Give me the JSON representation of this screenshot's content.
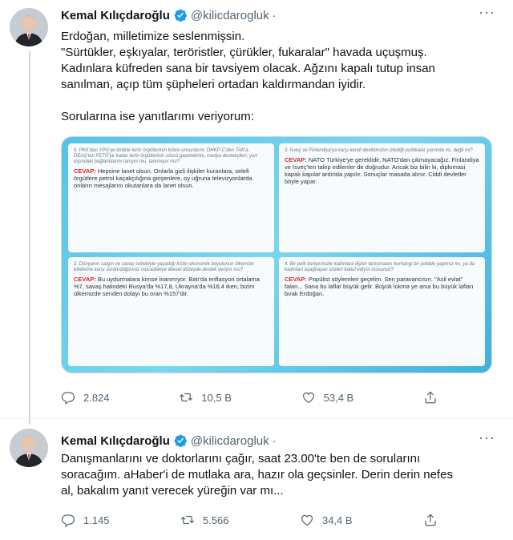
{
  "tweets": [
    {
      "author_name": "Kemal Kılıçdaroğlu",
      "handle": "@kilicdarogluk",
      "separator": "·",
      "lines": [
        "Erdoğan, milletimize seslenmişsin.",
        "\"Sürtükler, eşkıyalar, teröristler, çürükler, fukaralar\" havada uçuşmuş.",
        "Kadınlara küfreden sana bir tavsiyem olacak. Ağzını kapalı tutup insan",
        "sanılman, açıp tüm şüpheleri ortadan kaldırmandan iyidir.",
        "Sorularına ise yanıtlarımı veriyorum:"
      ],
      "media_panels": [
        {
          "question": "5. PKK'dan YPG'ye birlikte terör örgütlerinin listesi unsurlarını; DHKP-C'den TAK'a, DEAŞ'tan FETÖ'ye kadar terör örgütlerinin sözcü gazetelerini, medya destekçileri, yurt dışındaki bağlantılarını tanıyor mu, tanımıyor mu?",
          "label": "CEVAP:",
          "answer": "Hepsine lanet olsun. Onlarla gizli ilişkiler kuranlara, selefi örgütlere petrol kaçakçılığına girişenlere, oy uğruna televizyonlarda onların mesajlarını okutanlara da lanet olsun."
        },
        {
          "question": "3. İsveç ve Finlandiya'ya karşı kendi devletimizin izlediği politikalar yanında mı, değil mi?",
          "label": "CEVAP:",
          "answer": "NATO Türkiye'ye gereklidir, NATO'dan çıkmayacağız. Finlandiya ve İsveç'ten talep edilenler de doğrudur. Ancak biz bilin ki, diplomasi kapalı kapılar ardında yapılır. Sonuçlar masada alınır. Ciddi devletler böyle yapar."
        },
        {
          "question": "2. Dünyanın salgın ve savaş sebebiyle yaşadığı krizin ekonomik boyutunun ülkemize etkilerine karşı sürdürdüğümüz mücadeleye ilkesel düzeyde destek veriyor mu?",
          "label": "CEVAP:",
          "answer": "Bu uydurmalara kimse inanmıyor. Batı'da enflasyon ortalama %7, savaş halindeki Rusya'da %17,8, Ukrayna'da %16,4 iken, bizim ülkemizde senden dolayı bu oran %157'dir."
        },
        {
          "question": "4. Bir polit kariyerinizle kadınlara ilişkin tartışmaları herhangi bir şekilde yaptınız mı, ya da kadınları aşağılayan sözleri kabul ediyor musunuz?",
          "label": "CEVAP:",
          "answer": "Popülist söylemleri geçelim. Sen paravancısın. \"Asil evlat\" falan... Sana bu laflar büyük gelir. Büyük lokma ye ama bu büyük lafları bırak Erdoğan."
        }
      ],
      "actions": [
        {
          "icon": "reply-icon",
          "count": "2.824"
        },
        {
          "icon": "retweet-icon",
          "count": "10,5 B"
        },
        {
          "icon": "like-icon",
          "count": "53,4 B"
        },
        {
          "icon": "share-icon",
          "count": ""
        }
      ]
    },
    {
      "author_name": "Kemal Kılıçdaroğlu",
      "handle": "@kilicdarogluk",
      "separator": "·",
      "lines": [
        "Danışmanlarını ve doktorlarını çağır, saat 23.00'te ben de sorularını",
        "soracağım. aHaber'i de mutlaka ara, hazır ola geçsinler. Derin derin nefes",
        "al, bakalım yanıt verecek yüreğin var mı..."
      ],
      "actions": [
        {
          "icon": "reply-icon",
          "count": "1.145"
        },
        {
          "icon": "retweet-icon",
          "count": "5.566"
        },
        {
          "icon": "like-icon",
          "count": "34,4 B"
        },
        {
          "icon": "share-icon",
          "count": ""
        }
      ]
    }
  ],
  "colors": {
    "text": "#0f1419",
    "secondary": "#536471",
    "verified": "#1d9bf0",
    "cevap": "#e02424",
    "media_bg": "#54c3e8"
  }
}
